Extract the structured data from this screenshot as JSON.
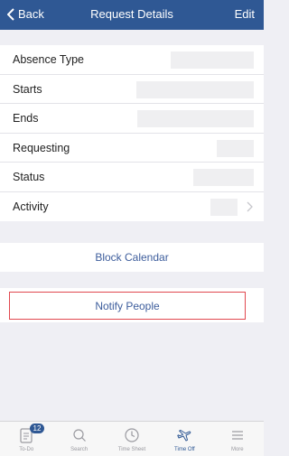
{
  "navbar": {
    "back_label": "Back",
    "title": "Request Details",
    "edit_label": "Edit"
  },
  "details": [
    {
      "label": "Absence Type"
    },
    {
      "label": "Starts"
    },
    {
      "label": "Ends"
    },
    {
      "label": "Requesting"
    },
    {
      "label": "Status"
    },
    {
      "label": "Activity"
    }
  ],
  "actions": {
    "block_calendar": "Block Calendar",
    "notify_people": "Notify People"
  },
  "tabbar": {
    "todo_badge": "12",
    "tabs": [
      {
        "label": "To-Do",
        "icon": "todo-icon"
      },
      {
        "label": "Search",
        "icon": "search-icon"
      },
      {
        "label": "Time Sheet",
        "icon": "clock-icon"
      },
      {
        "label": "Time Off",
        "icon": "plane-icon",
        "active": true
      },
      {
        "label": "More",
        "icon": "menu-icon"
      }
    ]
  },
  "colors": {
    "nav": "#2f5894",
    "link": "#3d5d9c",
    "notify_border": "#e1484f",
    "background": "#efeff4"
  }
}
